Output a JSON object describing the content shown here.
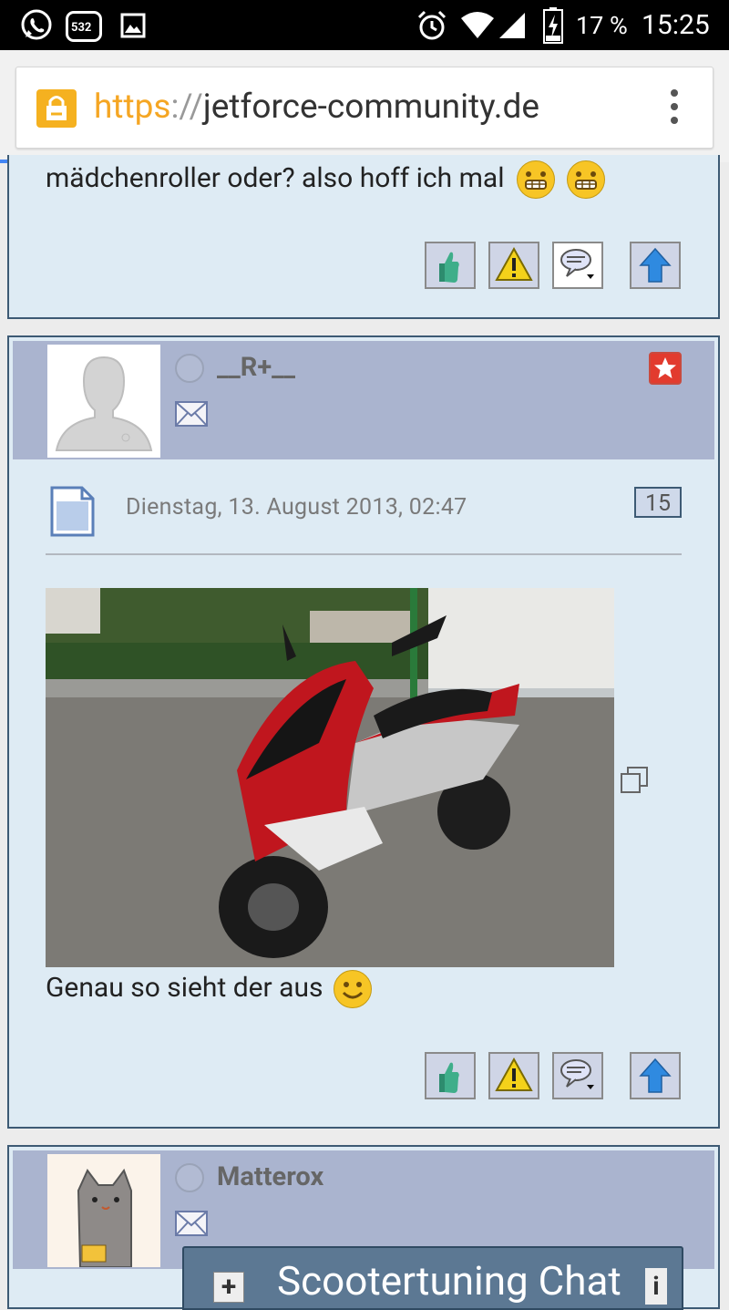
{
  "status_bar": {
    "notification_badge": "532",
    "battery": "17 %",
    "time": "15:25"
  },
  "browser": {
    "url_scheme": "https",
    "url_separator": "://",
    "url_host": "jetforce-community.de"
  },
  "posts": [
    {
      "text": "mädchenroller oder? also hoff ich mal"
    },
    {
      "username": "__R+__",
      "date": "Dienstag, 13. August 2013, 02:47",
      "post_number": "15",
      "text": "Genau so sieht der aus"
    },
    {
      "username": "Matterox"
    }
  ],
  "chat": {
    "title": "Scootertuning Chat"
  },
  "colors": {
    "post_bg": "#deebf4",
    "header_bg": "#aab4cf",
    "post_border": "#3d5a74",
    "progress": "#4285f4",
    "lock": "#f5b120"
  }
}
